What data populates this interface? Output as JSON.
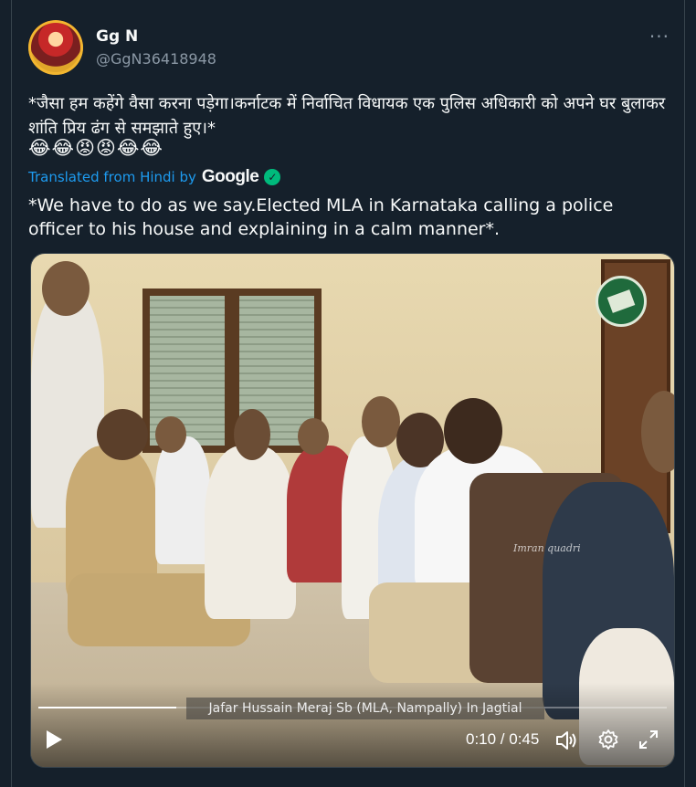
{
  "tweet": {
    "author_name": "Gg N",
    "author_handle": "@GgN36418948",
    "more_label": "···",
    "original_text": "*जैसा हम कहेंगे वैसा करना पड़ेगा।कर्नाटक में निर्वाचित विधायक एक पुलिस अधिकारी को अपने घर बुलाकर शांति प्रिय ढंग से समझाते हुए।*",
    "emojis": "😂😂😡😡😂😂",
    "translated_label": "Translated from Hindi by",
    "translator": "Google",
    "translated_text": "*We have to do as we say.Elected MLA in Karnataka calling a police officer to his house and explaining in a calm manner*."
  },
  "video": {
    "caption": "Jafar Hussain Meraj Sb (MLA, Nampally) In Jagtial",
    "watermark": "Imran quadri",
    "time_display": "0:10 / 0:45",
    "progress_fraction": 0.22
  },
  "colors": {
    "background": "#15202b",
    "accent": "#1d9bf0",
    "verified_green": "#00ba7c"
  }
}
